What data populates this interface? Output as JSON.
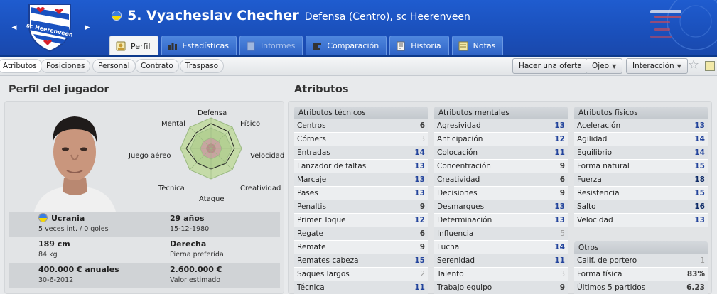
{
  "header": {
    "player_name": "5. Vyacheslav Checher",
    "player_subtitle": "Defensa (Centro), sc Heerenveen",
    "club_logo_text": "sc Heerenveen"
  },
  "tabs": [
    {
      "label": "Perfil",
      "icon": "profile-icon"
    },
    {
      "label": "Estadísticas",
      "icon": "stats-icon"
    },
    {
      "label": "Informes",
      "icon": "reports-icon"
    },
    {
      "label": "Comparación",
      "icon": "compare-icon"
    },
    {
      "label": "Historia",
      "icon": "history-icon"
    },
    {
      "label": "Notas",
      "icon": "notes-icon"
    }
  ],
  "subtabs": [
    "Atributos",
    "Posiciones",
    "Personal",
    "Contrato",
    "Traspaso"
  ],
  "toolbar": {
    "offer_label": "Hacer una oferta",
    "scout_label": "Ojeo",
    "interaction_label": "Interacción"
  },
  "profile": {
    "title": "Perfil del jugador",
    "radar_labels": {
      "defensa": "Defensa",
      "fisico": "Físico",
      "velocidad": "Velocidad",
      "creatividad": "Creatividad",
      "ataque": "Ataque",
      "tecnica": "Técnica",
      "juego_aereo": "Juego aéreo",
      "mental": "Mental"
    },
    "nationality": "Ucrania",
    "caps": "5 veces int. / 0 goles",
    "age": "29 años",
    "birth_date": "15-12-1980",
    "height": "189 cm",
    "weight": "84 kg",
    "foot": "Derecha",
    "foot_label": "Pierna preferida",
    "wage": "400.000 € anuales",
    "contract_end": "30-6-2012",
    "value": "2.600.000 €",
    "value_label": "Valor estimado"
  },
  "attributes": {
    "title": "Atributos",
    "technical": {
      "header": "Atributos técnicos",
      "rows": [
        [
          "Centros",
          "6"
        ],
        [
          "Córners",
          "3"
        ],
        [
          "Entradas",
          "14"
        ],
        [
          "Lanzador de faltas",
          "13"
        ],
        [
          "Marcaje",
          "13"
        ],
        [
          "Pases",
          "13"
        ],
        [
          "Penaltis",
          "9"
        ],
        [
          "Primer Toque",
          "12"
        ],
        [
          "Regate",
          "6"
        ],
        [
          "Remate",
          "9"
        ],
        [
          "Remates cabeza",
          "15"
        ],
        [
          "Saques largos",
          "2"
        ],
        [
          "Técnica",
          "11"
        ]
      ]
    },
    "mental": {
      "header": "Atributos mentales",
      "rows": [
        [
          "Agresividad",
          "13"
        ],
        [
          "Anticipación",
          "12"
        ],
        [
          "Colocación",
          "11"
        ],
        [
          "Concentración",
          "9"
        ],
        [
          "Creatividad",
          "6"
        ],
        [
          "Decisiones",
          "9"
        ],
        [
          "Desmarques",
          "13"
        ],
        [
          "Determinación",
          "13"
        ],
        [
          "Influencia",
          "5"
        ],
        [
          "Lucha",
          "14"
        ],
        [
          "Serenidad",
          "11"
        ],
        [
          "Talento",
          "3"
        ],
        [
          "Trabajo equipo",
          "9"
        ]
      ]
    },
    "physical": {
      "header": "Atributos físicos",
      "rows": [
        [
          "Aceleración",
          "13"
        ],
        [
          "Agilidad",
          "14"
        ],
        [
          "Equilibrio",
          "14"
        ],
        [
          "Forma natural",
          "15"
        ],
        [
          "Fuerza",
          "18"
        ],
        [
          "Resistencia",
          "15"
        ],
        [
          "Salto",
          "16"
        ],
        [
          "Velocidad",
          "13"
        ]
      ]
    },
    "other": {
      "header": "Otros",
      "rows": [
        [
          "Calif. de portero",
          "1"
        ],
        [
          "Forma física",
          "83%"
        ],
        [
          "Últimos 5 partidos",
          "6.23"
        ]
      ]
    }
  },
  "colors": {
    "header_blue": "#1f5ccf",
    "value_high": "#23449c",
    "value_low": "#9a9a9a"
  }
}
